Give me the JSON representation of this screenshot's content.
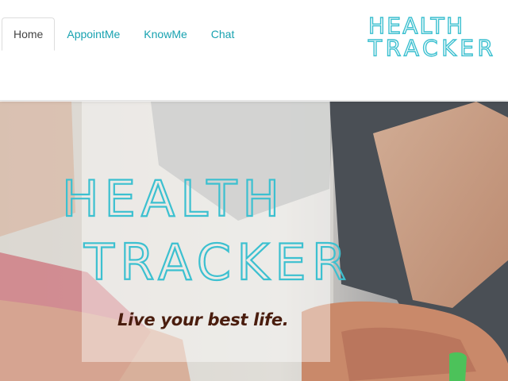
{
  "nav": {
    "tabs": [
      {
        "label": "Home",
        "active": true
      },
      {
        "label": "AppointMe",
        "active": false
      },
      {
        "label": "KnowMe",
        "active": false
      },
      {
        "label": "Chat",
        "active": false
      }
    ]
  },
  "brand": {
    "line1": "HEALTH",
    "line2": "TRACKER",
    "color": "#3cc0d0"
  },
  "hero": {
    "title_line1": "HEALTH",
    "title_line2": "TRACKER",
    "tagline": "Live your best life.",
    "title_color": "#3cc0d0",
    "tagline_color": "#4a1d0e"
  }
}
